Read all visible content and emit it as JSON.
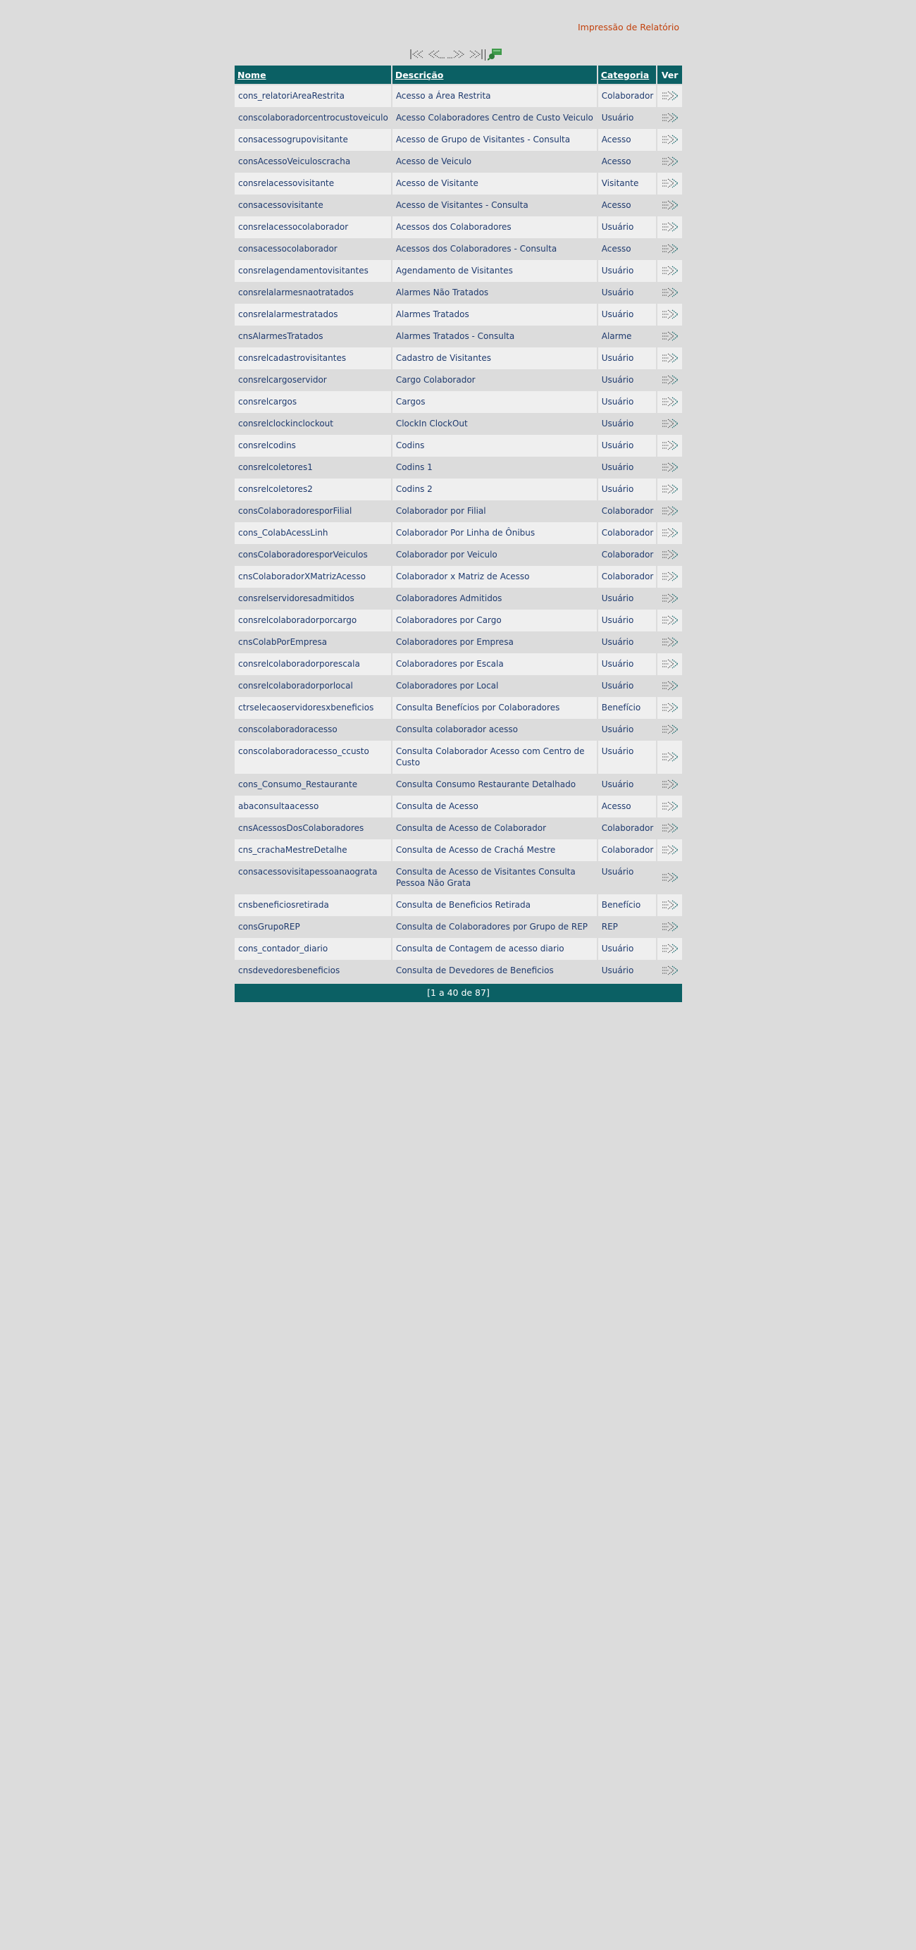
{
  "header": {
    "report_title": "Impressão de Relatório"
  },
  "pager": {
    "first_icon": "first-page-icon",
    "prev_icon": "previous-page-icon",
    "next_icon": "next-page-icon",
    "last_icon": "last-page-icon",
    "search_icon": "search-flag-icon"
  },
  "table": {
    "columns": {
      "nome": "Nome",
      "descricao": "Descrição",
      "categoria": "Categoria",
      "ver": "Ver"
    },
    "view_icon": "view-arrow-icon",
    "rows": [
      {
        "nome": "cons_relatoriAreaRestrita",
        "descricao": "Acesso a Área Restrita",
        "categoria": "Colaborador"
      },
      {
        "nome": "conscolaboradorcentrocustoveiculo",
        "descricao": "Acesso Colaboradores Centro de Custo Veiculo",
        "categoria": "Usuário"
      },
      {
        "nome": "consacessogrupovisitante",
        "descricao": "Acesso de Grupo de Visitantes - Consulta",
        "categoria": "Acesso"
      },
      {
        "nome": "consAcessoVeiculoscracha",
        "descricao": "Acesso de Veiculo",
        "categoria": "Acesso"
      },
      {
        "nome": "consrelacessovisitante",
        "descricao": "Acesso de Visitante",
        "categoria": "Visitante"
      },
      {
        "nome": "consacessovisitante",
        "descricao": "Acesso de Visitantes - Consulta",
        "categoria": "Acesso"
      },
      {
        "nome": "consrelacessocolaborador",
        "descricao": "Acessos dos Colaboradores",
        "categoria": "Usuário"
      },
      {
        "nome": "consacessocolaborador",
        "descricao": "Acessos dos Colaboradores - Consulta",
        "categoria": "Acesso"
      },
      {
        "nome": "consrelagendamentovisitantes",
        "descricao": "Agendamento de Visitantes",
        "categoria": "Usuário"
      },
      {
        "nome": "consrelalarmesnaotratados",
        "descricao": "Alarmes Não Tratados",
        "categoria": "Usuário"
      },
      {
        "nome": "consrelalarmestratados",
        "descricao": "Alarmes Tratados",
        "categoria": "Usuário"
      },
      {
        "nome": "cnsAlarmesTratados",
        "descricao": "Alarmes Tratados - Consulta",
        "categoria": "Alarme"
      },
      {
        "nome": "consrelcadastrovisitantes",
        "descricao": "Cadastro de Visitantes",
        "categoria": "Usuário"
      },
      {
        "nome": "consrelcargoservidor",
        "descricao": "Cargo Colaborador",
        "categoria": "Usuário"
      },
      {
        "nome": "consrelcargos",
        "descricao": "Cargos",
        "categoria": "Usuário"
      },
      {
        "nome": "consrelclockinclockout",
        "descricao": "ClockIn ClockOut",
        "categoria": "Usuário"
      },
      {
        "nome": "consrelcodins",
        "descricao": "Codins",
        "categoria": "Usuário"
      },
      {
        "nome": "consrelcoletores1",
        "descricao": "Codins 1",
        "categoria": "Usuário"
      },
      {
        "nome": "consrelcoletores2",
        "descricao": "Codins 2",
        "categoria": "Usuário"
      },
      {
        "nome": "consColaboradoresporFilial",
        "descricao": "Colaborador por Filial",
        "categoria": "Colaborador"
      },
      {
        "nome": "cons_ColabAcessLinh",
        "descricao": "Colaborador Por Linha de Ônibus",
        "categoria": "Colaborador"
      },
      {
        "nome": "consColaboradoresporVeiculos",
        "descricao": "Colaborador por Veiculo",
        "categoria": "Colaborador"
      },
      {
        "nome": "cnsColaboradorXMatrizAcesso",
        "descricao": "Colaborador x Matriz de Acesso",
        "categoria": "Colaborador"
      },
      {
        "nome": "consrelservidoresadmitidos",
        "descricao": "Colaboradores Admitidos",
        "categoria": "Usuário"
      },
      {
        "nome": "consrelcolaboradorporcargo",
        "descricao": "Colaboradores por Cargo",
        "categoria": "Usuário"
      },
      {
        "nome": "cnsColabPorEmpresa",
        "descricao": "Colaboradores por Empresa",
        "categoria": "Usuário"
      },
      {
        "nome": "consrelcolaboradorporescala",
        "descricao": "Colaboradores por Escala",
        "categoria": "Usuário"
      },
      {
        "nome": "consrelcolaboradorporlocal",
        "descricao": "Colaboradores por Local",
        "categoria": "Usuário"
      },
      {
        "nome": "ctrselecaoservidoresxbeneficios",
        "descricao": "Consulta Benefícios por Colaboradores",
        "categoria": "Benefício"
      },
      {
        "nome": "conscolaboradoracesso",
        "descricao": "Consulta colaborador acesso",
        "categoria": "Usuário"
      },
      {
        "nome": "conscolaboradoracesso_ccusto",
        "descricao": "Consulta Colaborador Acesso com Centro de Custo",
        "categoria": "Usuário"
      },
      {
        "nome": "cons_Consumo_Restaurante",
        "descricao": "Consulta Consumo Restaurante Detalhado",
        "categoria": "Usuário"
      },
      {
        "nome": "abaconsultaacesso",
        "descricao": "Consulta de Acesso",
        "categoria": "Acesso"
      },
      {
        "nome": "cnsAcessosDosColaboradores",
        "descricao": "Consulta de Acesso de Colaborador",
        "categoria": "Colaborador"
      },
      {
        "nome": "cns_crachaMestreDetalhe",
        "descricao": "Consulta de Acesso de Crachá Mestre",
        "categoria": "Colaborador"
      },
      {
        "nome": "consacessovisitapessoanaograta",
        "descricao": "Consulta de Acesso de Visitantes Consulta Pessoa Não Grata",
        "categoria": "Usuário"
      },
      {
        "nome": "cnsbeneficiosretirada",
        "descricao": "Consulta de Beneficios Retirada",
        "categoria": "Benefício"
      },
      {
        "nome": "consGrupoREP",
        "descricao": "Consulta de Colaboradores por Grupo de REP",
        "categoria": "REP"
      },
      {
        "nome": "cons_contador_diario",
        "descricao": "Consulta de Contagem de acesso diario",
        "categoria": "Usuário"
      },
      {
        "nome": "cnsdevedoresbeneficios",
        "descricao": "Consulta de Devedores de Beneficios",
        "categoria": "Usuário"
      }
    ]
  },
  "footer": {
    "range_text": "[1 a 40 de 87]"
  }
}
